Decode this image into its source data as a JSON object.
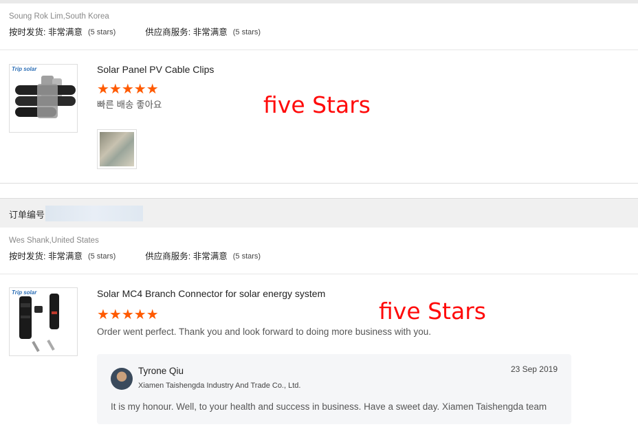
{
  "colors": {
    "star": "#ff5a00",
    "annotation": "#ff0a0a"
  },
  "reviews": [
    {
      "buyer": "Soung Rok Lim,South Korea",
      "ship_label": "按时发货: 非常满意",
      "ship_stars": "(5 stars)",
      "service_label": "供应商服务: 非常满意",
      "service_stars": "(5 stars)",
      "product_title": "Solar Panel PV Cable Clips",
      "rating": 5,
      "stars": "★★★★★",
      "comment": "빠른 배송 좋아요",
      "annotation": "five Stars",
      "logo": "Trip solar"
    },
    {
      "buyer": "Wes Shank,United States",
      "ship_label": "按时发货: 非常满意",
      "ship_stars": "(5 stars)",
      "service_label": "供应商服务: 非常满意",
      "service_stars": "(5 stars)",
      "product_title": "Solar MC4 Branch Connector for solar energy system",
      "rating": 5,
      "stars": "★★★★★",
      "comment": "Order went perfect. Thank you and look forward to doing more business with you.",
      "annotation": "five Stars",
      "logo": "Trip solar",
      "reply": {
        "name": "Tyrone Qiu",
        "company": "Xiamen Taishengda Industry And Trade Co., Ltd.",
        "date": "23 Sep 2019",
        "text": "It is my honour.  Well, to your health and success in business. Have a sweet day. Xiamen Taishengda team"
      }
    }
  ],
  "order_label": "订单编号"
}
